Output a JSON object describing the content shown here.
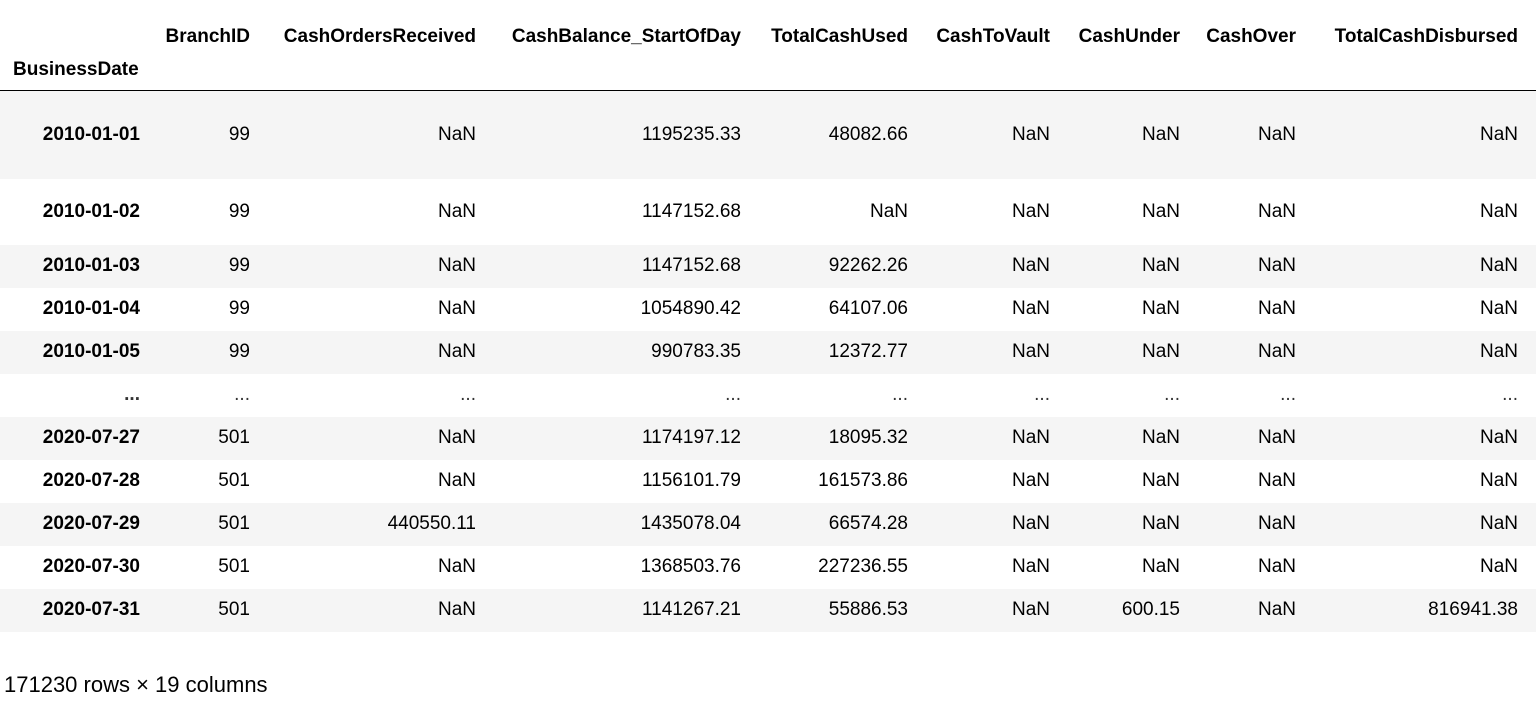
{
  "dataframe": {
    "index_name": "BusinessDate",
    "columns": [
      "BranchID",
      "CashOrdersReceived",
      "CashBalance_StartOfDay",
      "TotalCashUsed",
      "CashToVault",
      "CashUnder",
      "CashOver",
      "TotalCashDisbursed"
    ],
    "rows": [
      {
        "index": "2010-01-01",
        "cells": [
          "99",
          "NaN",
          "1195235.33",
          "48082.66",
          "NaN",
          "NaN",
          "NaN",
          "NaN"
        ]
      },
      {
        "index": "2010-01-02",
        "cells": [
          "99",
          "NaN",
          "1147152.68",
          "NaN",
          "NaN",
          "NaN",
          "NaN",
          "NaN"
        ]
      },
      {
        "index": "2010-01-03",
        "cells": [
          "99",
          "NaN",
          "1147152.68",
          "92262.26",
          "NaN",
          "NaN",
          "NaN",
          "NaN"
        ]
      },
      {
        "index": "2010-01-04",
        "cells": [
          "99",
          "NaN",
          "1054890.42",
          "64107.06",
          "NaN",
          "NaN",
          "NaN",
          "NaN"
        ]
      },
      {
        "index": "2010-01-05",
        "cells": [
          "99",
          "NaN",
          "990783.35",
          "12372.77",
          "NaN",
          "NaN",
          "NaN",
          "NaN"
        ]
      },
      {
        "index": "...",
        "cells": [
          "...",
          "...",
          "...",
          "...",
          "...",
          "...",
          "...",
          "..."
        ]
      },
      {
        "index": "2020-07-27",
        "cells": [
          "501",
          "NaN",
          "1174197.12",
          "18095.32",
          "NaN",
          "NaN",
          "NaN",
          "NaN"
        ]
      },
      {
        "index": "2020-07-28",
        "cells": [
          "501",
          "NaN",
          "1156101.79",
          "161573.86",
          "NaN",
          "NaN",
          "NaN",
          "NaN"
        ]
      },
      {
        "index": "2020-07-29",
        "cells": [
          "501",
          "440550.11",
          "1435078.04",
          "66574.28",
          "NaN",
          "NaN",
          "NaN",
          "NaN"
        ]
      },
      {
        "index": "2020-07-30",
        "cells": [
          "501",
          "NaN",
          "1368503.76",
          "227236.55",
          "NaN",
          "NaN",
          "NaN",
          "NaN"
        ]
      },
      {
        "index": "2020-07-31",
        "cells": [
          "501",
          "NaN",
          "1141267.21",
          "55886.53",
          "NaN",
          "600.15",
          "NaN",
          "816941.38"
        ]
      }
    ],
    "shape_text": "171230 rows × 19 columns"
  }
}
